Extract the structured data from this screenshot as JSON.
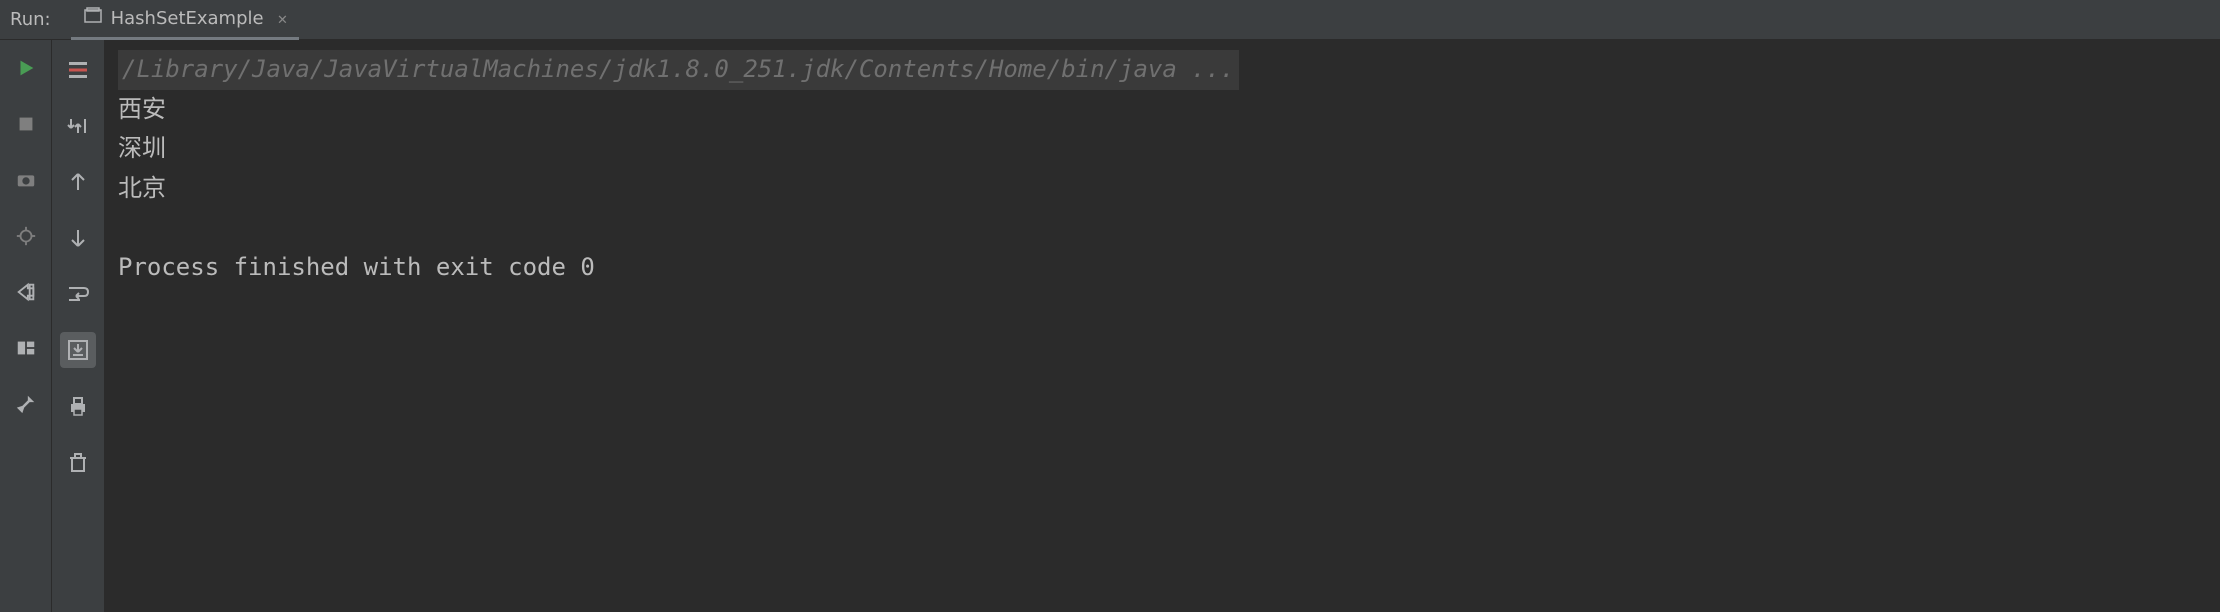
{
  "header": {
    "run_label": "Run:",
    "tab_title": "HashSetExample"
  },
  "console": {
    "command": "/Library/Java/JavaVirtualMachines/jdk1.8.0_251.jdk/Contents/Home/bin/java ...",
    "output_lines": [
      "西安",
      "深圳",
      "北京"
    ],
    "exit_message": "Process finished with exit code 0"
  },
  "colors": {
    "run_green": "#499c54",
    "icon_gray": "#afb1b3",
    "filter_red": "#c75450"
  }
}
